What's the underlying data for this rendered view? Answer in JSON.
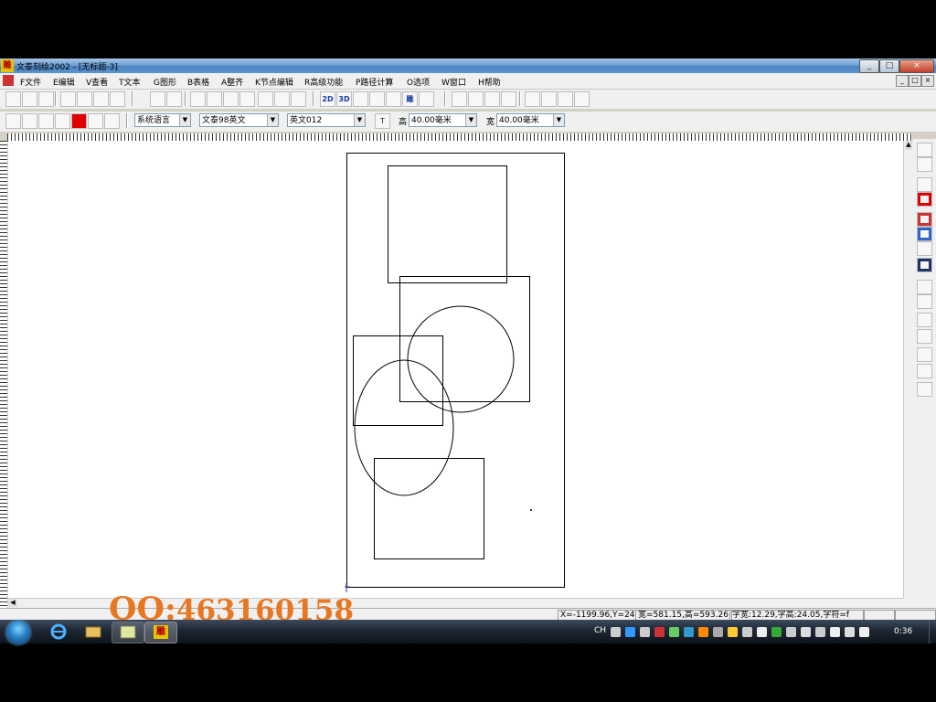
{
  "window": {
    "title": "文泰刻绘2002 - [无标题-3]",
    "icon_text": "雕",
    "buttons": {
      "minimize": "_",
      "maximize": "□",
      "close": "×"
    }
  },
  "menubar": {
    "items": [
      "F文件",
      "E编辑",
      "V查看",
      "T文本",
      "G图形",
      "B表格",
      "A整齐",
      "K节点编辑",
      "R高级功能",
      "P路径计算",
      "O选项",
      "W窗口",
      "H帮助"
    ],
    "mdi_buttons": [
      "_",
      "□",
      "×"
    ]
  },
  "toolbar1": {
    "buttons": [
      "new-icon",
      "open-icon",
      "save-icon",
      "cut-icon",
      "copy-icon",
      "paste-icon",
      "delete-icon",
      "undo-icon",
      "redo-icon",
      "print-icon",
      "scissors-cut-icon",
      "printer-icon",
      "preview-icon",
      "frame-icon",
      "lightbulb-icon",
      "help-icon",
      "2d-icon",
      "3d-icon",
      "grid-icon",
      "cross-icon",
      "shape-icon",
      "carve-icon",
      "text-tool-icon",
      "measure-icon",
      "triangle-icon",
      "slash-icon",
      "edit-icon",
      "align-left-icon",
      "align-center-icon",
      "align-right-icon",
      "justify-icon"
    ],
    "button_text": {
      "2d-icon": "2D",
      "3d-icon": "3D",
      "carve-icon": "雕"
    }
  },
  "toolbar2": {
    "zoom_buttons": [
      "zoom-in-icon",
      "zoom-out-icon",
      "zoom-select-icon",
      "pan-icon",
      "color-red-icon",
      "magnifier-icon",
      "zoom-fit-icon"
    ],
    "font_language": "系统语言",
    "font_chinese": "文泰98英文",
    "font_english": "英文012",
    "height_label": "高",
    "height_value": "40.00毫米",
    "width_label": "宽",
    "width_value": "40.00毫米"
  },
  "right_tools": [
    "pointer-icon",
    "text-icon",
    "node-icon",
    "rect-icon",
    "fill-icon",
    "fill2-icon",
    "shape3-icon",
    "table-icon",
    "grid2-icon",
    "arrow-icon",
    "list-icon",
    "doc-icon",
    "copy2-icon",
    "paste2-icon",
    "textframe-icon"
  ],
  "statusbar": {
    "coords": "X=-1199.96,Y=24!",
    "size": "宽=581.15,高=593.26",
    "font_info": "字宽:12.29,字高:24.05,字符=f"
  },
  "watermark": {
    "qq_label": "QQ:",
    "qq_number": "463160158"
  },
  "taskbar": {
    "lang": "CH",
    "clock": "0:36",
    "pinned": [
      "ie-icon",
      "explorer-icon",
      "app-icon",
      "carve-app-icon"
    ],
    "active_app_text": "雕"
  },
  "colors": {
    "accent": "#e87722",
    "title_blue": "#4a83c1"
  }
}
